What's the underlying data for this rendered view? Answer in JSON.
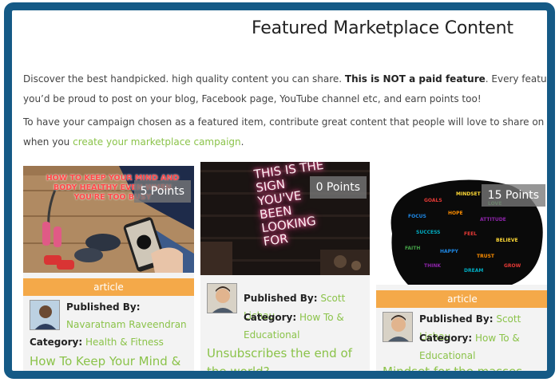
{
  "header": {
    "title": "Featured Marketplace Content"
  },
  "intro": {
    "p1_a": "Discover the best handpicked. high quality content you can share.",
    "p1_bold": "This is NOT a paid feature",
    "p1_b": ". Every featured item is careful",
    "p1_line2": "you’d be proud to post on your blog, Facebook page, YouTube channel etc, and earn points too!",
    "p2_line1": "To have your campaign chosen as a featured item, contribute great content that people will love to share on their sites and c",
    "p2_pre": "when you ",
    "p2_link": "create your marketplace campaign",
    "p2_post": "."
  },
  "labels": {
    "published_by": "Published By:",
    "category": "Category:"
  },
  "cards": [
    {
      "points": "5 Points",
      "image_caption": "HOW TO KEEP YOUR MIND AND BODY HEALTHY EVEN WHEN YOU'RE TOO BUSY",
      "type": "article",
      "author": "Navaratnam Raveendran",
      "category": "Health & Fitness",
      "title": "How To Keep Your Mind & Body Healthy Even When"
    },
    {
      "points": "0 Points",
      "image_caption": "THIS IS THE SIGN YOU'VE BEEN LOOKING FOR",
      "type": "",
      "author": "Scott Lichau",
      "category": "How To & Educational",
      "title": "Unsubscribes the end of the world?"
    },
    {
      "points": "15 Points",
      "image_caption": "",
      "type": "article",
      "author": "Scott Lichau",
      "category": "How To & Educational",
      "title": "Mindset for the masses"
    }
  ],
  "colors": {
    "frame": "#155a86",
    "accent_green": "#8bc34a",
    "tag_orange": "#f4a949",
    "points_bg": "#787878"
  }
}
